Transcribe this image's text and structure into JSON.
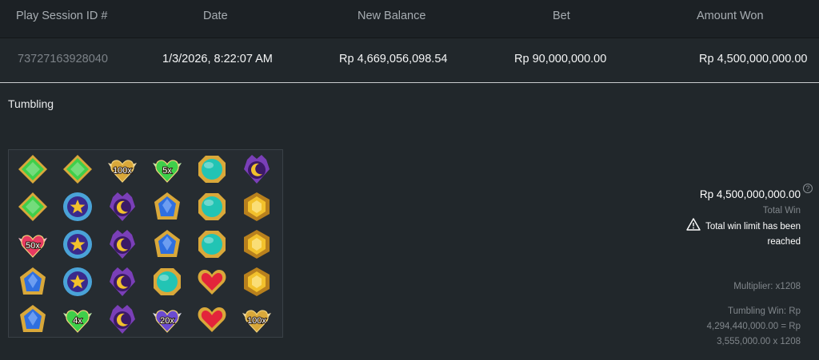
{
  "table": {
    "headers": {
      "play_session": "Play Session ID #",
      "date": "Date",
      "new_balance": "New Balance",
      "bet": "Bet",
      "amount_won": "Amount Won"
    },
    "row": {
      "play_session": "73727163928040",
      "date": "1/3/2026, 8:22:07 AM",
      "new_balance": "Rp 4,669,056,098.54",
      "bet": "Rp 90,000,000.00",
      "amount_won": "Rp 4,500,000,000.00"
    }
  },
  "detail": {
    "section_title": "Tumbling",
    "total_win_amount": "Rp 4,500,000,000.00",
    "help_glyph": "?",
    "total_win_label": "Total Win",
    "limit_message": "Total win limit has been reached",
    "multiplier": "Multiplier: x1208",
    "tumbling_win": "Tumbling Win: Rp 4,294,440,000.00 = Rp 3,555,000.00 x 1208"
  },
  "reels": {
    "columns": [
      [
        "green-gem",
        "green-gem",
        "multiplier-50x",
        "blue-gem",
        "blue-gem"
      ],
      [
        "green-gem",
        "star-shield",
        "star-shield",
        "star-shield",
        "multiplier-4x"
      ],
      [
        "multiplier-100x",
        "moon-crown",
        "moon-crown",
        "moon-crown",
        "moon-crown"
      ],
      [
        "multiplier-5x",
        "blue-gem",
        "blue-gem",
        "teal-orb",
        "multiplier-20x"
      ],
      [
        "teal-orb",
        "teal-orb",
        "teal-orb",
        "red-heart",
        "red-heart"
      ],
      [
        "moon-crown",
        "yellow-gem",
        "yellow-gem",
        "yellow-gem",
        "multiplier-100x"
      ]
    ],
    "multiplier_labels": {
      "multiplier-100x": "100x",
      "multiplier-5x": "5x",
      "multiplier-50x": "50x",
      "multiplier-4x": "4x",
      "multiplier-20x": "20x"
    },
    "colors": {
      "green": "#3fcf4a",
      "blue": "#2f6fe0",
      "teal": "#22c4b4",
      "red": "#e3243b",
      "yellow": "#f2c12c",
      "purple": "#7a3fb8",
      "gold_frame": "#d9a83a"
    }
  }
}
